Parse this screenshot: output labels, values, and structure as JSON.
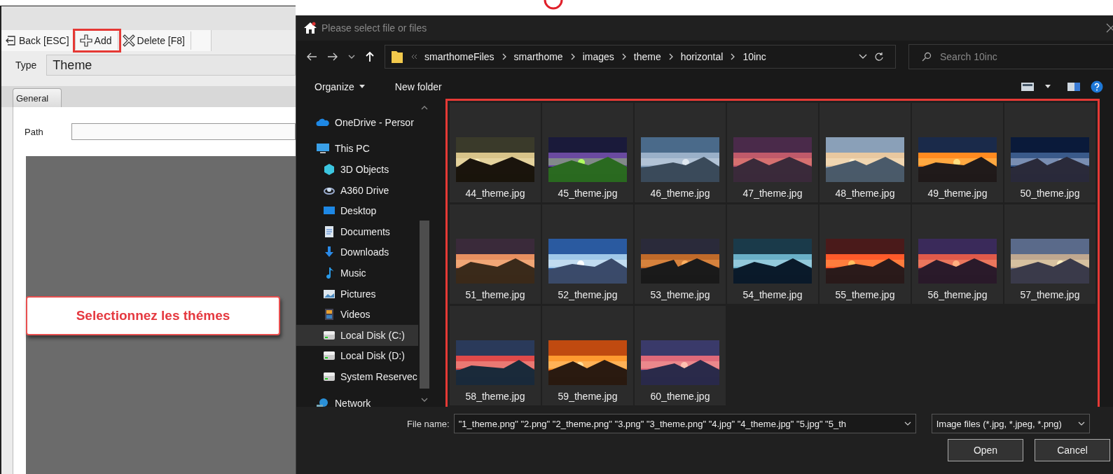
{
  "app": {
    "toolbar": [
      {
        "label": "Back [ESC]",
        "kind": "back",
        "highlighted": false
      },
      {
        "label": "Add",
        "kind": "add",
        "highlighted": true
      },
      {
        "label": "Delete [F8]",
        "kind": "delete",
        "highlighted": false
      }
    ],
    "type_label": "Type",
    "type_value": "Theme",
    "tabs": [
      {
        "label": "General",
        "selected": true
      }
    ],
    "path_label": "Path",
    "callout": "Selectionnez les thémes"
  },
  "dialog": {
    "title": "Please select file or files",
    "breadcrumbs": [
      "smarthomeFiles",
      "smarthome",
      "images",
      "theme",
      "horizontal",
      "10inc"
    ],
    "search_placeholder": "Search 10inc",
    "organize": "Organize",
    "new_folder": "New folder",
    "nav": [
      {
        "label": "OneDrive - Persor",
        "kind": "cloud",
        "selected": false
      },
      {
        "label": "This PC",
        "kind": "pc",
        "selected": false,
        "children": [
          {
            "label": "3D Objects",
            "kind": "cube",
            "selected": false
          },
          {
            "label": "A360 Drive",
            "kind": "ring",
            "selected": false
          },
          {
            "label": "Desktop",
            "kind": "desktop",
            "selected": false
          },
          {
            "label": "Documents",
            "kind": "document",
            "selected": false
          },
          {
            "label": "Downloads",
            "kind": "download",
            "selected": false
          },
          {
            "label": "Music",
            "kind": "music",
            "selected": false
          },
          {
            "label": "Pictures",
            "kind": "pictures",
            "selected": false
          },
          {
            "label": "Videos",
            "kind": "videos",
            "selected": false
          },
          {
            "label": "Local Disk (C:)",
            "kind": "disk",
            "selected": true
          },
          {
            "label": "Local Disk (D:)",
            "kind": "disk",
            "selected": false
          },
          {
            "label": "System Reservec",
            "kind": "disk",
            "selected": false
          }
        ]
      },
      {
        "label": "Network",
        "kind": "network",
        "selected": false
      }
    ],
    "files_highlighted": true,
    "files": [
      {
        "name": "44_theme.jpg",
        "kind": "picture"
      },
      {
        "name": "45_theme.jpg",
        "kind": "picture"
      },
      {
        "name": "46_theme.jpg",
        "kind": "picture"
      },
      {
        "name": "47_theme.jpg",
        "kind": "picture"
      },
      {
        "name": "48_theme.jpg",
        "kind": "picture"
      },
      {
        "name": "49_theme.jpg",
        "kind": "picture"
      },
      {
        "name": "50_theme.jpg",
        "kind": "picture"
      },
      {
        "name": "51_theme.jpg",
        "kind": "picture"
      },
      {
        "name": "52_theme.jpg",
        "kind": "picture"
      },
      {
        "name": "53_theme.jpg",
        "kind": "picture"
      },
      {
        "name": "54_theme.jpg",
        "kind": "picture"
      },
      {
        "name": "55_theme.jpg",
        "kind": "picture"
      },
      {
        "name": "56_theme.jpg",
        "kind": "picture"
      },
      {
        "name": "57_theme.jpg",
        "kind": "picture"
      },
      {
        "name": "58_theme.jpg",
        "kind": "picture"
      },
      {
        "name": "59_theme.jpg",
        "kind": "picture"
      },
      {
        "name": "60_theme.jpg",
        "kind": "picture"
      }
    ],
    "file_name_label": "File name:",
    "file_name_value": "\"1_theme.png\" \"2.png\" \"2_theme.png\" \"3.png\" \"3_theme.png\" \"4.jpg\" \"4_theme.jpg\" \"5.jpg\" \"5_th",
    "file_type": "Image files (*.jpg, *.jpeg, *.png)",
    "buttons": [
      "Open",
      "Cancel"
    ]
  }
}
